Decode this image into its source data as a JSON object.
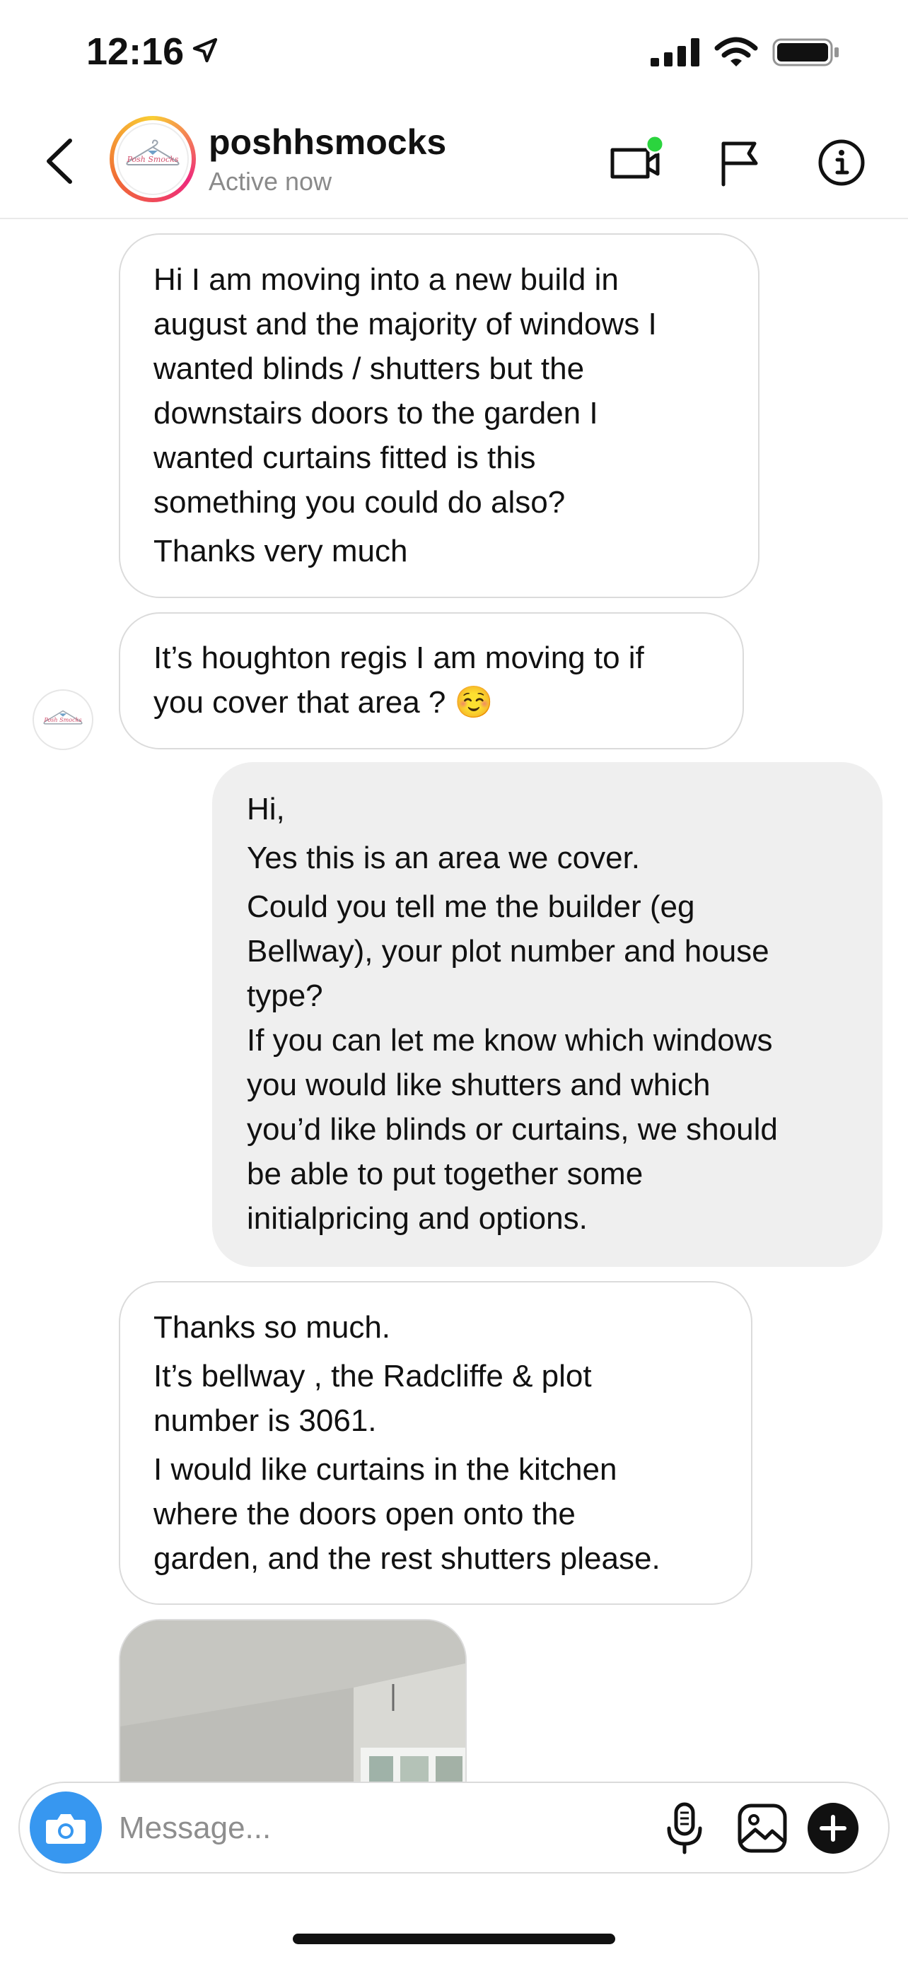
{
  "status_bar": {
    "time": "12:16"
  },
  "header": {
    "username": "poshhsmocks",
    "status": "Active now",
    "avatar_text": "Posh Smocks"
  },
  "messages": [
    {
      "from": "them",
      "lines": [
        "Hi I am moving into a new build in",
        "august and the majority of windows I",
        "wanted blinds / shutters but the",
        "downstairs doors to the garden I",
        "wanted curtains fitted is this",
        "something you could do also?",
        "Thanks very much"
      ]
    },
    {
      "from": "them",
      "lines": [
        "It’s houghton regis I am moving to if",
        "you cover that area ? ☺️"
      ]
    },
    {
      "from": "me",
      "lines": [
        "Hi,",
        "Yes this is an area we cover.",
        "Could you tell me the builder (eg",
        "Bellway), your plot number and house",
        "type?",
        "If you can let me know which windows",
        "you would like shutters and which",
        "you’d like blinds or curtains, we should",
        "be able to put together some",
        "initialpricing and options."
      ]
    },
    {
      "from": "them",
      "lines": [
        "Thanks so much.",
        "It’s bellway , the Radcliffe & plot",
        "number is 3061.",
        "I would like curtains in the kitchen",
        "where the doors open onto the",
        "garden, and the rest shutters please."
      ]
    }
  ],
  "composer": {
    "placeholder": "Message..."
  },
  "colors": {
    "accent_blue": "#3797f0",
    "online_green": "#2bd43e",
    "outgoing_bubble": "#efefef",
    "incoming_border": "#dbdbdb"
  },
  "icons": {
    "back": "chevron-left-icon",
    "video": "video-call-icon",
    "flag": "flag-icon",
    "info": "info-icon",
    "camera": "camera-icon",
    "mic": "microphone-icon",
    "gallery": "gallery-icon",
    "sticker": "plus-circle-icon"
  }
}
